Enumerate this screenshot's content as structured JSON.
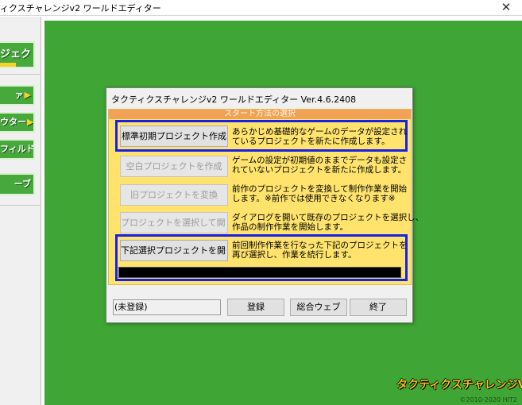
{
  "window": {
    "title": "ィクスチャレンジv2 ワールドエディター",
    "close_glyph": "✕"
  },
  "sidebar": {
    "items": [
      {
        "label": "ジェクト",
        "arrow": ""
      },
      {
        "label": "ァ",
        "arrow": "▶"
      },
      {
        "label": "ウター",
        "arrow": "▶"
      },
      {
        "label": "フィルド",
        "arrow": "▶"
      },
      {
        "label": "ーブ",
        "arrow": ""
      }
    ]
  },
  "branding": {
    "logo": "タクティクスチャレンジV",
    "copyright": "©2010-2020 HIT2"
  },
  "dialog": {
    "title": "タクティクスチャレンジv2 ワールドエディター Ver.4.6.2408",
    "section_header": "スタート方法の選択",
    "options": [
      {
        "button": "標準初期プロジェクト作成",
        "desc1": "あらかじめ基礎的なゲームのデータが設定され",
        "desc2": "ているプロジェクトを新たに作成します。"
      },
      {
        "button": "空白プロジェクトを作成",
        "desc1": "ゲームの設定が初期値のままでデータも設定さ",
        "desc2": "れていないプロジェクトを新たに作成します。"
      },
      {
        "button": "旧プロジェクトを変換",
        "desc1": "前作のプロジェクトを変換して制作作業を開始",
        "desc2": "します。※前作では使用できなくなります※"
      },
      {
        "button": "プロジェクトを選択して開く",
        "desc1": "ダイアログを開いて既存のプロジェクトを選択し、",
        "desc2": "作品の制作作業を開始します。"
      },
      {
        "button": "下記選択プロジェクトを開く",
        "desc1": "前回制作作業を行なった下記のプロジェクトを",
        "desc2": "再び選択し、作業を続行します。"
      }
    ],
    "user_field": "(未登録)",
    "buttons": {
      "register": "登録",
      "web": "総合ウェブ",
      "exit": "終了"
    }
  },
  "colors": {
    "green_bg": "#3fa534",
    "panel_yellow": "#ffe36c",
    "header_orange": "#f2a256",
    "highlight_blue": "#1520e8"
  }
}
